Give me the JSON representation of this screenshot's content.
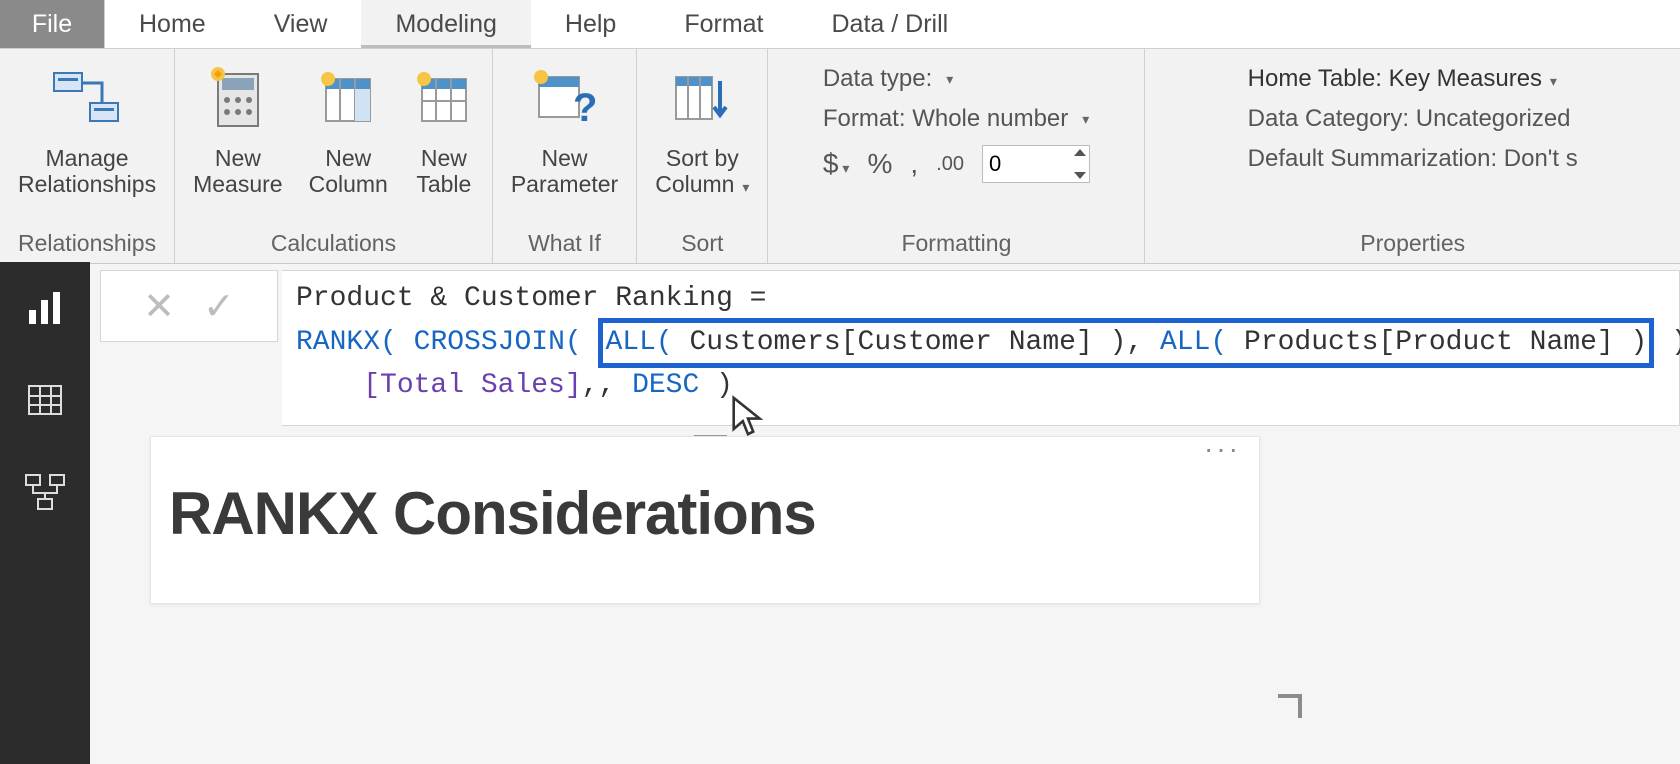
{
  "tabs": {
    "file": "File",
    "items": [
      "Home",
      "View",
      "Modeling",
      "Help",
      "Format",
      "Data / Drill"
    ],
    "active_index": 2
  },
  "ribbon": {
    "relationships": {
      "manage": "Manage\nRelationships",
      "group": "Relationships"
    },
    "calculations": {
      "measure": "New\nMeasure",
      "column": "New\nColumn",
      "table": "New\nTable",
      "group": "Calculations"
    },
    "whatif": {
      "param": "New\nParameter",
      "group": "What If"
    },
    "sort": {
      "sortby": "Sort by\nColumn",
      "group": "Sort"
    },
    "formatting": {
      "datatype_label": "Data type:",
      "format_label": "Format: Whole number",
      "currency": "$",
      "percent": "%",
      "thousands": ",",
      "decimals_icon": ".00",
      "decimals_value": "0",
      "group": "Formatting"
    },
    "properties": {
      "home_table": "Home Table: Key Measures",
      "data_category": "Data Category: Uncategorized",
      "default_summ": "Default Summarization: Don't s",
      "group": "Properties"
    }
  },
  "formula": {
    "cancel": "✕",
    "commit": "✓",
    "line1_name": "Product & Customer Ranking = ",
    "rankx": "RANKX(",
    "crossjoin": "CROSSJOIN(",
    "all1_fn": "ALL(",
    "all1_arg": " Customers[Customer Name] )",
    "sep": ", ",
    "all2_fn": "ALL(",
    "all2_arg": " Products[Product Name] )",
    "close_cj": " ),",
    "indent": "    ",
    "measure": "[Total Sales]",
    "after_measure": ",, ",
    "desc": "DESC",
    "close_rx": " )"
  },
  "visual": {
    "menu": "···",
    "title": "RANKX Considerations"
  }
}
